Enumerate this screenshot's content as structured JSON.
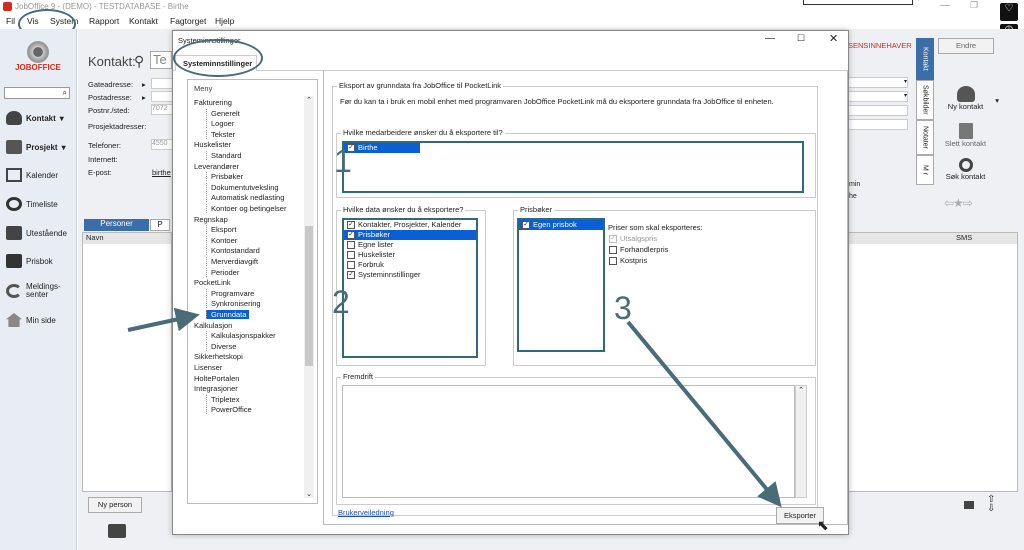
{
  "window": {
    "title": "JobOffice 9 - (DEMO) - TESTDATABASE - Birthe"
  },
  "menu": [
    "Fil",
    "Vis",
    "System",
    "Rapport",
    "Kontakt",
    "Fagtorget",
    "Hjelp"
  ],
  "leftnav": {
    "logo": "JOBOFFICE",
    "items": [
      "Kontakt",
      "Prosjekt",
      "Kalender",
      "Timeliste",
      "Utestående",
      "Prisbok",
      "Meldings-\nsenter",
      "Min side"
    ]
  },
  "contact": {
    "title": "Kontakt:",
    "title_input_partial": "Te",
    "labels": [
      "Gateadresse:",
      "Postadresse:",
      "Postnr./sted:",
      "Prosjektadresser:",
      "Telefoner:",
      "Internett:",
      "E-post:"
    ],
    "postnr": "7072",
    "telefon": "4550",
    "epost": "birthe",
    "tabs": [
      "Personer",
      "P"
    ],
    "grid_header": "Navn",
    "new_person": "Ny person"
  },
  "right": {
    "ansvarlig": "SENSINNEHAVER",
    "endre": "Endre",
    "sidetabs": [
      "Kontakt",
      "Søkbilder",
      "Notater",
      "M r"
    ],
    "buttons": [
      "Ny kontakt",
      "Slett kontakt",
      "Søk kontakt"
    ],
    "sms": "SMS",
    "min": "min",
    "he": "he"
  },
  "dialog": {
    "title": "Systeminnstillinger",
    "tab": "Systeminnstillinger",
    "menu_label": "Meny",
    "tree": [
      {
        "t": "Fakturering",
        "l": 0
      },
      {
        "t": "Generelt",
        "l": 1
      },
      {
        "t": "Logoer",
        "l": 1
      },
      {
        "t": "Tekster",
        "l": 1
      },
      {
        "t": "Huskelister",
        "l": 0
      },
      {
        "t": "Standard",
        "l": 1
      },
      {
        "t": "Leverandører",
        "l": 0
      },
      {
        "t": "Prisbøker",
        "l": 1
      },
      {
        "t": "Dokumentutveksling",
        "l": 1
      },
      {
        "t": "Automatisk nedlasting",
        "l": 1
      },
      {
        "t": "Kontoer og betingelser",
        "l": 1
      },
      {
        "t": "Regnskap",
        "l": 0
      },
      {
        "t": "Eksport",
        "l": 1
      },
      {
        "t": "Kontoer",
        "l": 1
      },
      {
        "t": "Kontostandard",
        "l": 1
      },
      {
        "t": "Merverdiavgift",
        "l": 1
      },
      {
        "t": "Perioder",
        "l": 1
      },
      {
        "t": "PocketLink",
        "l": 0
      },
      {
        "t": "Programvare",
        "l": 1
      },
      {
        "t": "Synkronisering",
        "l": 1
      },
      {
        "t": "Grunndata",
        "l": 1,
        "sel": true
      },
      {
        "t": "Kalkulasjon",
        "l": 0
      },
      {
        "t": "Kalkulasjonspakker",
        "l": 1
      },
      {
        "t": "Diverse",
        "l": 1
      },
      {
        "t": "Sikkerhetskopi",
        "l": 0
      },
      {
        "t": "Lisenser",
        "l": 0
      },
      {
        "t": "HoltePortalen",
        "l": 0
      },
      {
        "t": "Integrasjoner",
        "l": 0
      },
      {
        "t": "Tripletex",
        "l": 1
      },
      {
        "t": "PowerOffice",
        "l": 1
      }
    ],
    "section_title": "Eksport av grunndata fra JobOffice til PocketLink",
    "info": "Før du kan ta i bruk en mobil enhet med programvaren JobOffice PocketLink må du eksportere grunndata fra JobOffice til enheten.",
    "employees_label": "Hvilke medarbeidere ønsker du å eksportere til?",
    "employees": [
      "Birthe"
    ],
    "data_label": "Hvilke data ønsker du å eksportere?",
    "data_items": [
      {
        "t": "Kontakter, Prosjekter, Kalender",
        "c": true
      },
      {
        "t": "Prisbøker",
        "c": true,
        "sel": true
      },
      {
        "t": "Egne lister",
        "c": false
      },
      {
        "t": "Huskelister",
        "c": false
      },
      {
        "t": "Forbruk",
        "c": false
      },
      {
        "t": "Systeminnstillinger",
        "c": true
      }
    ],
    "pricebooks_label": "Prisbøker",
    "pricebooks": [
      "Egen prisbok"
    ],
    "prices_label": "Priser som skal eksporteres:",
    "prices": [
      {
        "t": "Utsalgspris",
        "c": true,
        "dis": true
      },
      {
        "t": "Forhandlerpris",
        "c": false
      },
      {
        "t": "Kostpris",
        "c": false
      }
    ],
    "progress_label": "Fremdrift",
    "guide_link": "Brukerveiledning",
    "export_button": "Eksporter"
  },
  "annotations": [
    "1",
    "2",
    "3"
  ],
  "colors": {
    "accent": "#2e6b7a",
    "selection": "#0a5fd6",
    "brand_red": "#d62b1f"
  }
}
